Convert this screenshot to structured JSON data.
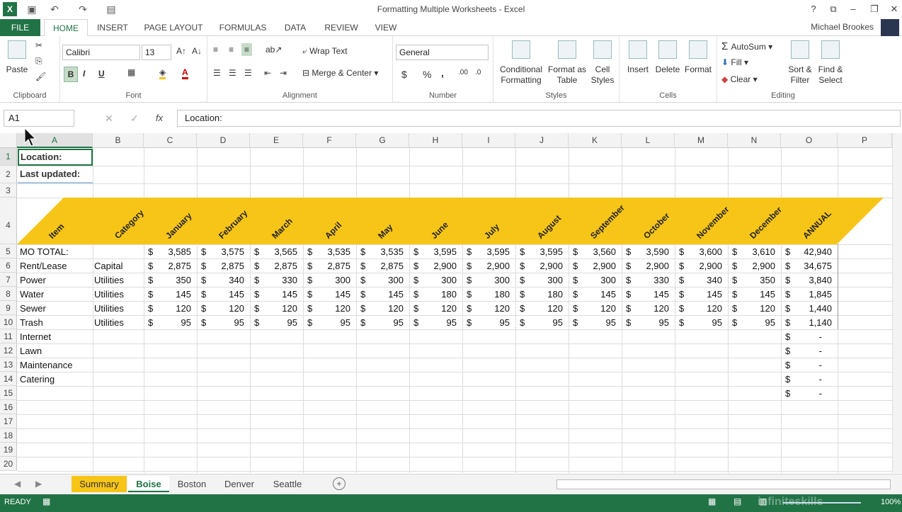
{
  "window": {
    "title": "Formatting Multiple Worksheets - Excel",
    "help": "?",
    "user": "Michael Brookes"
  },
  "ribbon_tabs": [
    "FILE",
    "HOME",
    "INSERT",
    "PAGE LAYOUT",
    "FORMULAS",
    "DATA",
    "REVIEW",
    "VIEW"
  ],
  "ribbon": {
    "clipboard": {
      "label": "Clipboard",
      "paste": "Paste"
    },
    "font": {
      "label": "Font",
      "name": "Calibri",
      "size": "13",
      "bold": "B",
      "italic": "I",
      "underline": "U"
    },
    "alignment": {
      "label": "Alignment",
      "wrap": "Wrap Text",
      "merge": "Merge & Center"
    },
    "number": {
      "label": "Number",
      "format": "General",
      "currency": "$",
      "percent": "%",
      "comma": ","
    },
    "styles": {
      "label": "Styles",
      "conditional": "Conditional",
      "conditional2": "Formatting",
      "format_table": "Format as",
      "format_table2": "Table",
      "cell_styles": "Cell",
      "cell_styles2": "Styles"
    },
    "cells": {
      "label": "Cells",
      "insert": "Insert",
      "delete": "Delete",
      "format": "Format"
    },
    "editing": {
      "label": "Editing",
      "autosum": "AutoSum",
      "fill": "Fill",
      "clear": "Clear",
      "sort": "Sort &",
      "sort2": "Filter",
      "find": "Find &",
      "find2": "Select"
    }
  },
  "formula_bar": {
    "name_box": "A1",
    "fx": "fx",
    "content": "Location:"
  },
  "columns": [
    "A",
    "B",
    "C",
    "D",
    "E",
    "F",
    "G",
    "H",
    "I",
    "J",
    "K",
    "L",
    "M",
    "N",
    "O",
    "P"
  ],
  "row_numbers": [
    "1",
    "2",
    "3",
    "4",
    "5",
    "6",
    "7",
    "8",
    "9",
    "10",
    "11",
    "12",
    "13",
    "14",
    "15",
    "16",
    "17",
    "18",
    "19",
    "20"
  ],
  "info": {
    "location": "Location:",
    "last_updated": "Last updated:"
  },
  "header_labels": [
    "Item",
    "Category",
    "January",
    "February",
    "March",
    "April",
    "May",
    "June",
    "July",
    "August",
    "September",
    "October",
    "November",
    "December",
    "ANNUAL"
  ],
  "rows": [
    {
      "item": "MO TOTAL:",
      "category": "",
      "values": [
        "3,585",
        "3,575",
        "3,565",
        "3,535",
        "3,535",
        "3,595",
        "3,595",
        "3,595",
        "3,560",
        "3,590",
        "3,600",
        "3,610"
      ],
      "annual": "42,940"
    },
    {
      "item": "Rent/Lease",
      "category": "Capital",
      "values": [
        "2,875",
        "2,875",
        "2,875",
        "2,875",
        "2,875",
        "2,900",
        "2,900",
        "2,900",
        "2,900",
        "2,900",
        "2,900",
        "2,900"
      ],
      "annual": "34,675"
    },
    {
      "item": "Power",
      "category": "Utilities",
      "values": [
        "350",
        "340",
        "330",
        "300",
        "300",
        "300",
        "300",
        "300",
        "300",
        "330",
        "340",
        "350"
      ],
      "annual": "3,840"
    },
    {
      "item": "Water",
      "category": "Utilities",
      "values": [
        "145",
        "145",
        "145",
        "145",
        "145",
        "180",
        "180",
        "180",
        "145",
        "145",
        "145",
        "145"
      ],
      "annual": "1,845"
    },
    {
      "item": "Sewer",
      "category": "Utilities",
      "values": [
        "120",
        "120",
        "120",
        "120",
        "120",
        "120",
        "120",
        "120",
        "120",
        "120",
        "120",
        "120"
      ],
      "annual": "1,440"
    },
    {
      "item": "Trash",
      "category": "Utilities",
      "values": [
        "95",
        "95",
        "95",
        "95",
        "95",
        "95",
        "95",
        "95",
        "95",
        "95",
        "95",
        "95"
      ],
      "annual": "1,140"
    },
    {
      "item": "Internet",
      "category": "",
      "values": [],
      "annual": "-"
    },
    {
      "item": "Lawn",
      "category": "",
      "values": [],
      "annual": "-"
    },
    {
      "item": "Maintenance",
      "category": "",
      "values": [],
      "annual": "-"
    },
    {
      "item": "Catering",
      "category": "",
      "values": [],
      "annual": "-"
    },
    {
      "item": "",
      "category": "",
      "values": [],
      "annual": "-"
    }
  ],
  "currency_symbol": "$",
  "sheets": [
    "Summary",
    "Boise",
    "Boston",
    "Denver",
    "Seattle"
  ],
  "active_sheet": "Boise",
  "status": {
    "ready": "READY",
    "zoom": "100%",
    "watermark": "infiniteskills"
  },
  "colors": {
    "excel_green": "#217346",
    "header_band": "#f6c518",
    "summary_tab": "#f6c518"
  }
}
